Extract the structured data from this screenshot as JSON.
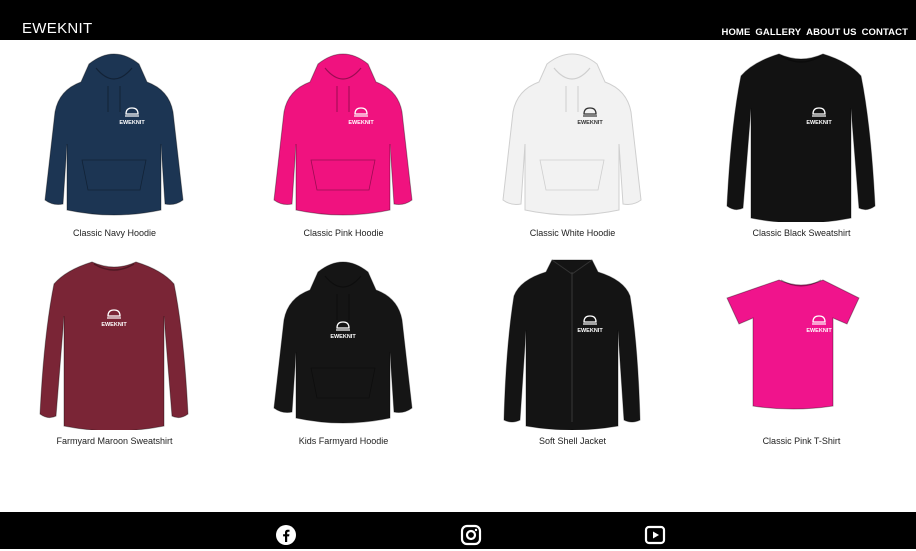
{
  "header": {
    "brand": "EWEKNIT"
  },
  "nav": [
    {
      "label": "HOME"
    },
    {
      "label": "GALLERY"
    },
    {
      "label": "ABOUT US"
    },
    {
      "label": "CONTACT"
    }
  ],
  "gallery": [
    {
      "caption": "Classic Navy Hoodie",
      "color": "#1c3553",
      "kind": "hoodie"
    },
    {
      "caption": "Classic Pink Hoodie",
      "color": "#f0127f",
      "kind": "hoodie"
    },
    {
      "caption": "Classic White Hoodie",
      "color": "#f2f2f2",
      "kind": "hoodie"
    },
    {
      "caption": "Classic Black Sweatshirt",
      "color": "#121212",
      "kind": "sweatshirt"
    },
    {
      "caption": "Farmyard Maroon Sweatshirt",
      "color": "#7a2536",
      "kind": "sweatshirt"
    },
    {
      "caption": "Kids Farmyard Hoodie",
      "color": "#151515",
      "kind": "hoodie"
    },
    {
      "caption": "Soft Shell Jacket",
      "color": "#141414",
      "kind": "jacket"
    },
    {
      "caption": "Classic Pink T-Shirt",
      "color": "#f0148c",
      "kind": "tshirt"
    }
  ],
  "footer": {
    "icons": [
      "facebook-icon",
      "instagram-icon",
      "youtube-icon"
    ]
  }
}
